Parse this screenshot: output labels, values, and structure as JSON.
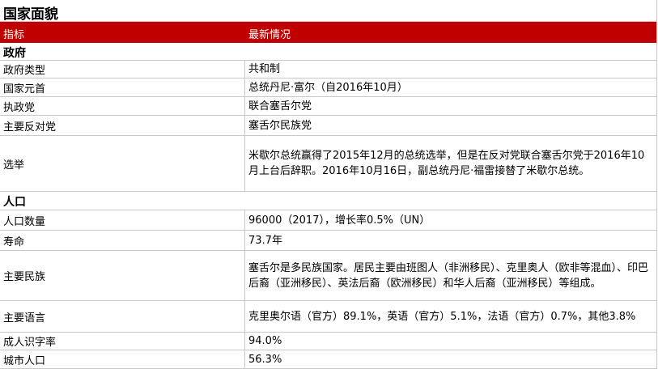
{
  "title": "国家面貌",
  "header": {
    "col1": "指标",
    "col2": "最新情况"
  },
  "sections": {
    "government": "政府",
    "population": "人口"
  },
  "rows": [
    {
      "label": "政府类型",
      "value": "共和制"
    },
    {
      "label": "国家元首",
      "value": "总统丹尼·富尔（自2016年10月）"
    },
    {
      "label": "执政党",
      "value": "联合塞舌尔党"
    },
    {
      "label": "主要反对党",
      "value": "塞舌尔民族党"
    },
    {
      "label": "选举",
      "value": "米歇尔总统赢得了2015年12月的总统选举，但是在反对党联合塞舌尔党于2016年10月上台后辞职。2016年10月16日，副总统丹尼·福雷接替了米歇尔总统。"
    },
    {
      "label": "人口数量",
      "value": "96000（2017），增长率0.5%（UN）"
    },
    {
      "label": "寿命",
      "value": "73.7年"
    },
    {
      "label": "主要民族",
      "value": "塞舌尔是多民族国家。居民主要由班图人（非洲移民）、克里奥人（欧非等混血）、印巴后裔（亚洲移民）、英法后裔（欧洲移民）和华人后裔（亚洲移民）等组成。"
    },
    {
      "label": "主要语言",
      "value": "克里奥尔语（官方）89.1%，英语（官方）5.1%，法语（官方）0.7%，其他3.8%"
    },
    {
      "label": "成人识字率",
      "value": "94.0%"
    },
    {
      "label": "城市人口",
      "value": "56.3%"
    }
  ]
}
